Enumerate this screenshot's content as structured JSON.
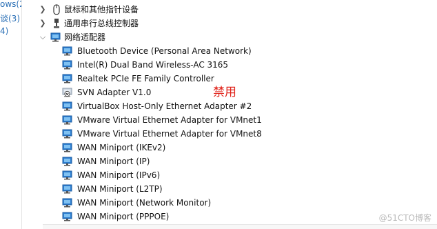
{
  "left_panel": {
    "fragments": [
      "ows(2",
      "谈(3)",
      "4)"
    ]
  },
  "tree": {
    "mouse_category": "鼠标和其他指针设备",
    "usb_category": "通用串行总线控制器",
    "network_category": "网络适配器",
    "adapters": [
      {
        "label": "Bluetooth Device (Personal Area Network)",
        "disabled": false
      },
      {
        "label": "Intel(R) Dual Band Wireless-AC 3165",
        "disabled": false
      },
      {
        "label": "Realtek PCIe FE Family Controller",
        "disabled": false
      },
      {
        "label": "SVN Adapter V1.0",
        "disabled": true
      },
      {
        "label": "VirtualBox Host-Only Ethernet Adapter #2",
        "disabled": false
      },
      {
        "label": "VMware Virtual Ethernet Adapter for VMnet1",
        "disabled": false
      },
      {
        "label": "VMware Virtual Ethernet Adapter for VMnet8",
        "disabled": false
      },
      {
        "label": "WAN Miniport (IKEv2)",
        "disabled": false
      },
      {
        "label": "WAN Miniport (IP)",
        "disabled": false
      },
      {
        "label": "WAN Miniport (IPv6)",
        "disabled": false
      },
      {
        "label": "WAN Miniport (L2TP)",
        "disabled": false
      },
      {
        "label": "WAN Miniport (Network Monitor)",
        "disabled": false
      },
      {
        "label": "WAN Miniport (PPPOE)",
        "disabled": false
      }
    ]
  },
  "annotation": "禁用",
  "watermark": "@51CTO博客",
  "colors": {
    "annotation": "#e0241b",
    "link": "#2a6fb6",
    "monitor_icon": "#2e7fd0"
  }
}
